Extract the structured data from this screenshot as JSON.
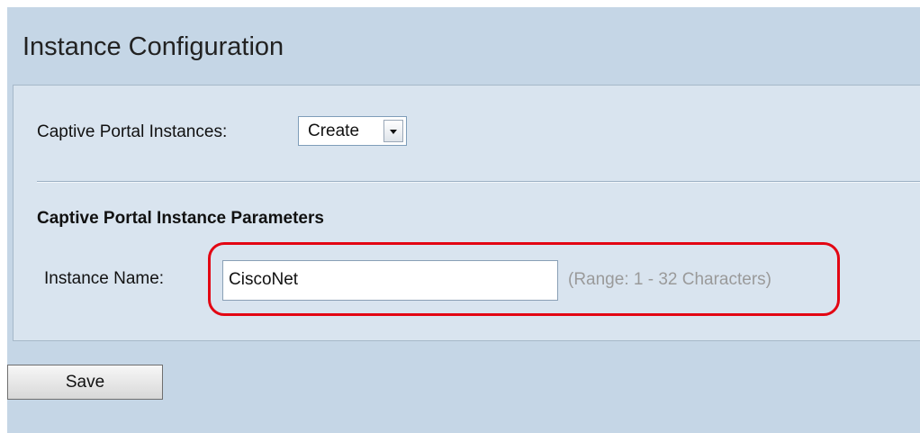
{
  "header": {
    "title": "Instance Configuration"
  },
  "instances": {
    "label": "Captive Portal Instances:",
    "select_value": "Create"
  },
  "parameters": {
    "section_title": "Captive Portal Instance Parameters",
    "instance_name_label": "Instance Name:",
    "instance_name_value": "CiscoNet",
    "range_hint": "(Range: 1 - 32 Characters)"
  },
  "actions": {
    "save_label": "Save"
  },
  "colors": {
    "page_background": "#c5d6e6",
    "panel_background": "#d9e4ef",
    "highlight_outline": "#e30613",
    "hint_text": "#9a9a9a"
  },
  "icons": {
    "dropdown": "chevron-down-icon"
  }
}
